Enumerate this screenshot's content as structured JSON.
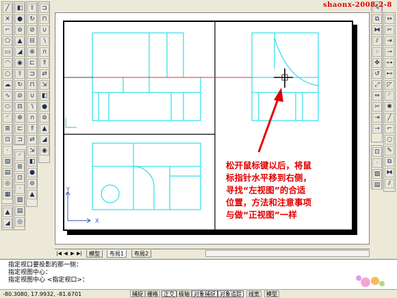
{
  "watermark": "shaonx-2008-2-8",
  "left_toolbar_1": {
    "icons": [
      "line-icon",
      "construction-line-icon",
      "polyline-icon",
      "polygon-icon",
      "rectangle-icon",
      "arc-icon",
      "circle-icon",
      "revision-cloud-icon",
      "spline-icon",
      "ellipse-icon",
      "ellipse-arc-icon",
      "insert-block-icon",
      "make-block-icon",
      "point-icon",
      "hatch-icon",
      "gradient-icon",
      "region-icon",
      "table-icon",
      "multiline-text-icon"
    ]
  },
  "left_toolbar_2": {
    "icons": [
      "box-icon",
      "sphere-icon",
      "cylinder-icon",
      "cone-icon",
      "wedge-icon",
      "torus-icon",
      "extrude-icon",
      "revolve-icon",
      "slice-icon",
      "section-icon",
      "interfere-icon",
      "setup-drawing-icon",
      "setup-view-icon",
      "setup-profile-icon",
      "union-icon",
      "subtract-icon",
      "intersect-icon",
      "extrude-faces-icon",
      "move-faces-icon",
      "offset-faces-icon"
    ]
  },
  "right_toolbar": {
    "icons": [
      "erase-icon",
      "copy-icon",
      "mirror-icon",
      "offset-icon",
      "array-icon",
      "move-icon",
      "rotate-icon",
      "scale-icon",
      "stretch-icon",
      "trim-icon",
      "extend-icon",
      "break-at-point-icon",
      "break-icon",
      "join-icon",
      "chamfer-icon",
      "fillet-icon",
      "explode-icon",
      "line-icon",
      "polyline-icon",
      "circle-icon"
    ]
  },
  "annotation": {
    "lines": [
      "松开鼠标键以后，将鼠",
      "标指针水平移到右侧，",
      "寻找“左视图”的合适",
      "位置，方法和注意事项",
      "与做“正视图”一样"
    ],
    "color": "#e00000"
  },
  "ucs": {
    "x_label": "X",
    "y_label": "Y"
  },
  "layout_tabs": [
    "模型",
    "布局1",
    "布局2"
  ],
  "active_tab": "布局1",
  "command_lines": [
    "指定视口要投影的那一侧：",
    "指定视图中心：",
    "指定视图中心 <指定视口>："
  ],
  "status_bar": {
    "coordinates": "-80.3080, 17.9932, -81.6701",
    "buttons": [
      {
        "label": "捕捉",
        "on": false
      },
      {
        "label": "栅格",
        "on": false
      },
      {
        "label": "正交",
        "on": true
      },
      {
        "label": "极轴",
        "on": false
      },
      {
        "label": "对象捕捉",
        "on": true
      },
      {
        "label": "对象追踪",
        "on": true
      },
      {
        "label": "线宽",
        "on": false
      },
      {
        "label": "模型",
        "on": false
      }
    ]
  },
  "colors": {
    "geometry": "#00d8e8",
    "construction": "#e03030",
    "viewport_border": "#000000"
  }
}
